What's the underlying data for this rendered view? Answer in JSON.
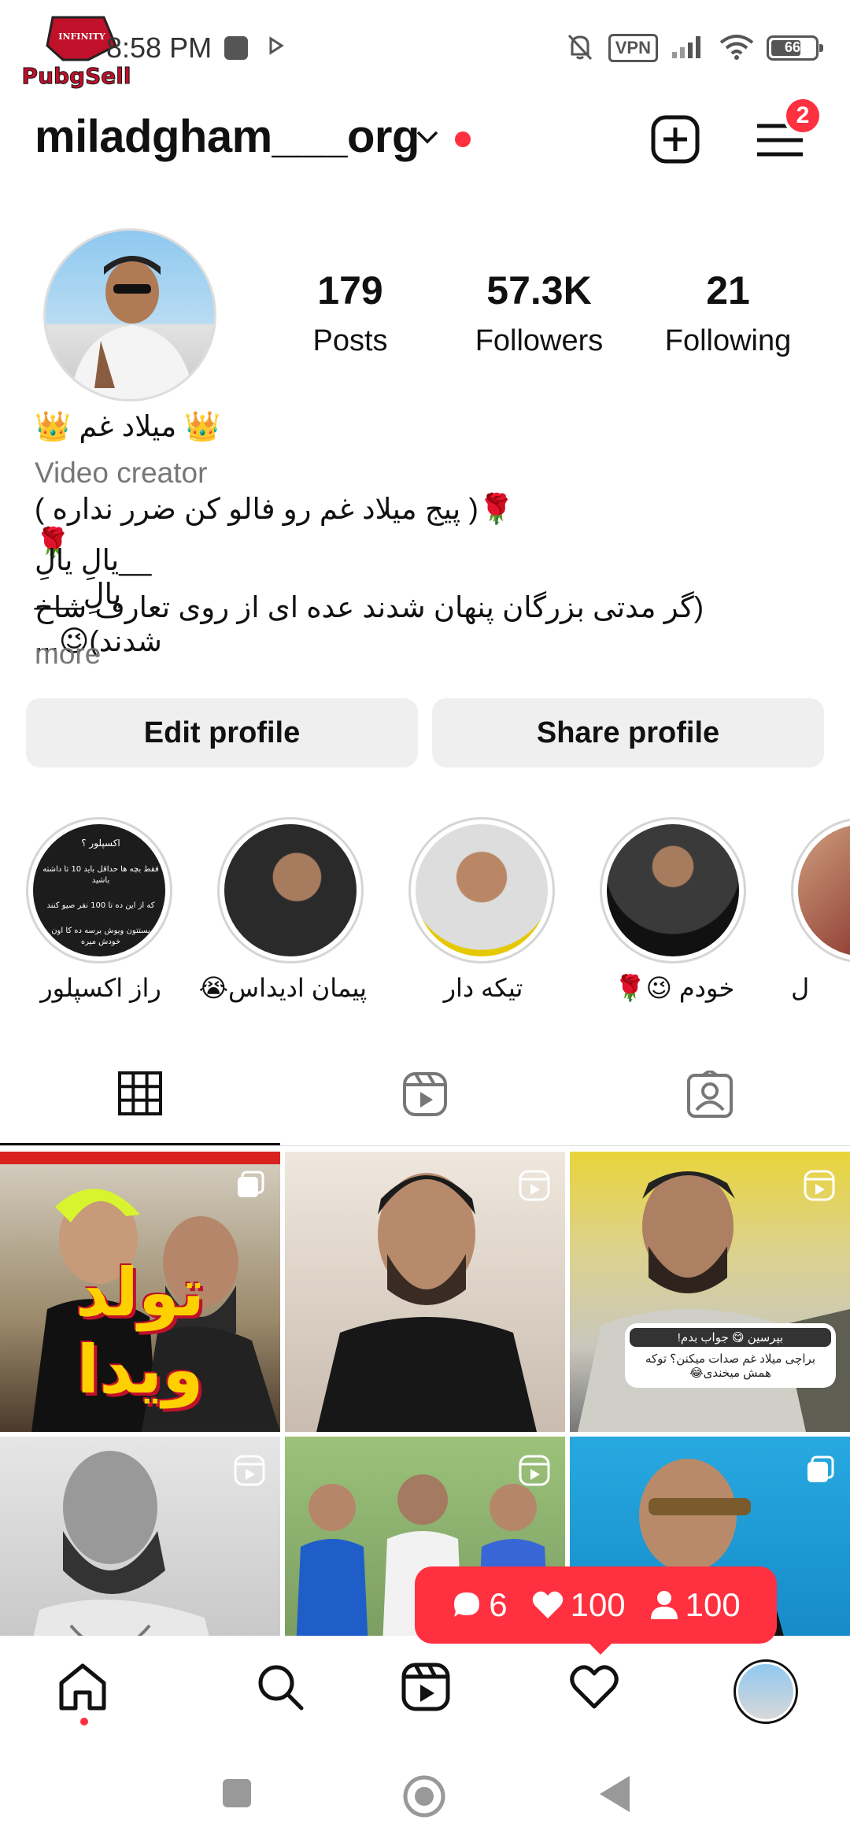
{
  "status_bar": {
    "watermark_text": "PubgSell",
    "watermark_badge": "INFINITY",
    "time": "8:58 PM",
    "vpn_label": "VPN",
    "battery_level": "66",
    "icons": [
      "bell-off-icon",
      "vpn-icon",
      "signal-icon",
      "wifi-icon",
      "battery-icon"
    ]
  },
  "header": {
    "username": "miladgham___org",
    "notifications_count": "2"
  },
  "profile": {
    "stats": [
      {
        "value": "179",
        "label": "Posts"
      },
      {
        "value": "57.3K",
        "label": "Followers"
      },
      {
        "value": "21",
        "label": "Following"
      }
    ],
    "display_name": "👑 میلاد غم 👑",
    "category": "Video creator",
    "bio_line1": "🌹( پیج  میلاد غم رو فالو کن ضرر نداره )🌹",
    "bio_line2": "__یالِ یالِ یالِ___",
    "bio_line3": "(گر مدتی بزرگان پنهان شدند عده ای از روی تعارف شاخ شدند)😉...",
    "more_label": "more"
  },
  "buttons": {
    "edit_profile": "Edit profile",
    "share_profile": "Share profile"
  },
  "highlights": [
    {
      "caption": "راز اکسپلور",
      "text": "اکسپلور ؟\nفقط بچه ها حداقل باید 10 تا داشته باشید\nکه از این ده تا 100 نفر صیو کنند\nپستتون ویوش برسه ده کا اون خودش میره"
    },
    {
      "caption": "پیمان ادیداس😭"
    },
    {
      "caption": "تیکه دار"
    },
    {
      "caption": "خودم 😉🌹"
    },
    {
      "caption": "ل"
    }
  ],
  "tabs": [
    "grid-icon",
    "reels-icon",
    "tagged-icon"
  ],
  "grid": [
    {
      "overlay": "تولد ویدا",
      "icon": "multi-post-icon"
    },
    {
      "icon": "reel-icon"
    },
    {
      "icon": "reel-icon",
      "question_header": "بپرسین 😋 جواب بدم!",
      "question_text": "براچی میلاد غم صدات میکنن؟ توکه همش میخندی😂"
    },
    {
      "icon": "reel-icon"
    },
    {
      "icon": "reel-icon"
    },
    {
      "icon": "multi-post-icon"
    }
  ],
  "activity": {
    "comments": "6",
    "likes": "100",
    "followers": "100"
  },
  "colors": {
    "accent_red": "#ff3040",
    "button_bg": "#efefef",
    "muted_text": "#777777"
  }
}
